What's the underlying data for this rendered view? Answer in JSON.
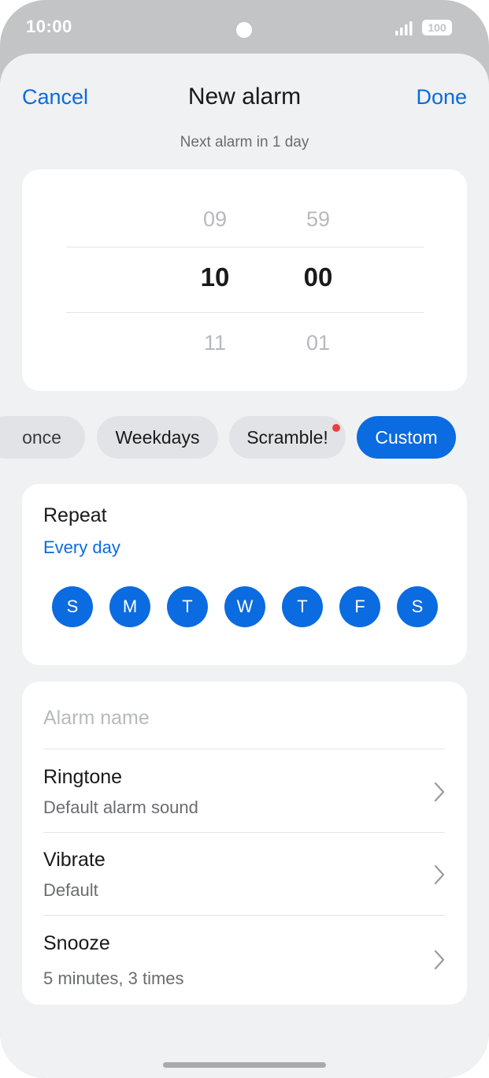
{
  "status_bar": {
    "time": "10:00",
    "battery": "100",
    "icons": [
      "signal-icon",
      "battery-icon"
    ]
  },
  "nav": {
    "cancel_label": "Cancel",
    "title": "New alarm",
    "done_label": "Done"
  },
  "subtitle": "Next alarm in 1 day",
  "time_picker": {
    "hours": {
      "prev": "09",
      "current": "10",
      "next": "11"
    },
    "minutes": {
      "prev": "59",
      "current": "00",
      "next": "01"
    }
  },
  "presets": {
    "items": [
      {
        "label": "once",
        "selected": false
      },
      {
        "label": "Weekdays",
        "selected": false
      },
      {
        "label": "Scramble!",
        "selected": false,
        "badge": true
      },
      {
        "label": "Custom",
        "selected": true
      }
    ],
    "accent": "#0b6be0",
    "badge_color": "#e8403b"
  },
  "repeat": {
    "title": "Repeat",
    "value": "Every day",
    "days": [
      "S",
      "M",
      "T",
      "W",
      "T",
      "F",
      "S"
    ]
  },
  "settings": {
    "name_placeholder": "Alarm name",
    "name_value": "",
    "ringtone": {
      "title": "Ringtone",
      "value": "Default alarm sound"
    },
    "vibrate": {
      "title": "Vibrate",
      "value": "Default"
    },
    "snooze": {
      "title": "Snooze",
      "value": "5 minutes, 3 times"
    },
    "chevron_icon": "chevron-right-icon"
  }
}
